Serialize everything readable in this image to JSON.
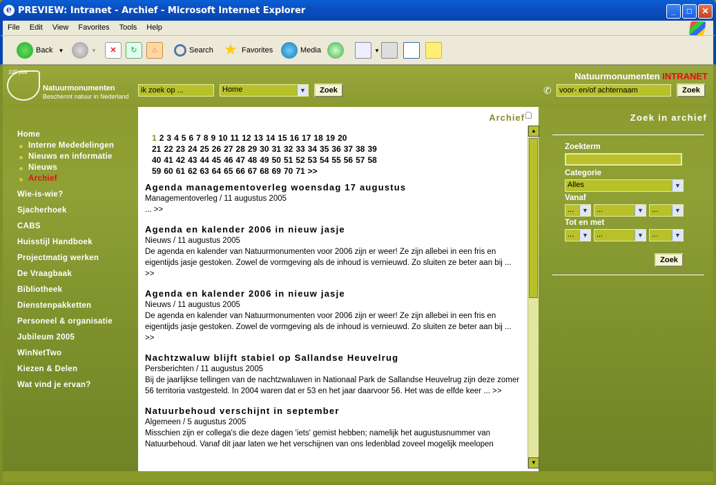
{
  "window": {
    "title": "PREVIEW: Intranet - Archief - Microsoft Internet Explorer",
    "min": "_",
    "max": "□",
    "close": "✕"
  },
  "menu": [
    "File",
    "Edit",
    "View",
    "Favorites",
    "Tools",
    "Help"
  ],
  "toolbar": {
    "back": "Back",
    "search": "Search",
    "favorites": "Favorites",
    "media": "Media"
  },
  "header": {
    "logo_year": "100 jaar",
    "logo_name": "Natuurmonumenten",
    "logo_tagline": "Beschermt natuur in Nederland",
    "search_placeholder": "ik zoek op ...",
    "scope_value": "Home",
    "search_button": "Zoek",
    "brand": "Natuurmonumenten",
    "brand_red": "INTRANET",
    "person_placeholder": "voor- en/of achternaam",
    "person_button": "Zoek"
  },
  "nav": {
    "home": "Home",
    "subs": [
      "Interne Mededelingen",
      "Nieuws en informatie",
      "Nieuws",
      "Archief"
    ],
    "items": [
      "Wie-is-wie?",
      "Sjacherhoek",
      "CABS",
      "Huisstijl Handboek",
      "Projectmatig werken",
      "De Vraagbaak",
      "Bibliotheek",
      "Dienstenpakketten",
      "Personeel & organisatie",
      "Jubileum 2005",
      "WinNetTwo",
      "Kiezen & Delen",
      "Wat vind je ervan?"
    ]
  },
  "content": {
    "title": "Archief",
    "pagination": [
      "1",
      "2",
      "3",
      "4",
      "5",
      "6",
      "7",
      "8",
      "9",
      "10",
      "11",
      "12",
      "13",
      "14",
      "15",
      "16",
      "17",
      "18",
      "19",
      "20",
      "21",
      "22",
      "23",
      "24",
      "25",
      "26",
      "27",
      "28",
      "29",
      "30",
      "31",
      "32",
      "33",
      "34",
      "35",
      "36",
      "37",
      "38",
      "39",
      "40",
      "41",
      "42",
      "43",
      "44",
      "45",
      "46",
      "47",
      "48",
      "49",
      "50",
      "51",
      "52",
      "53",
      "54",
      "55",
      "56",
      "57",
      "58",
      "59",
      "60",
      "61",
      "62",
      "63",
      "64",
      "65",
      "66",
      "67",
      "68",
      "69",
      "70",
      "71",
      ">>"
    ],
    "articles": [
      {
        "title": "Agenda managementoverleg woensdag 17 augustus",
        "meta": "Managementoverleg / 11 augustus 2005",
        "text": "... >>"
      },
      {
        "title": "Agenda en kalender 2006 in nieuw jasje",
        "meta": "Nieuws / 11 augustus 2005",
        "text": "De agenda en kalender van Natuurmonumenten voor 2006 zijn er weer! Ze zijn allebei in een fris en eigentijds jasje gestoken. Zowel de vormgeving als de inhoud is vernieuwd. Zo sluiten ze beter aan bij ... >>"
      },
      {
        "title": "Agenda en kalender 2006 in nieuw jasje",
        "meta": "Nieuws / 11 augustus 2005",
        "text": "De agenda en kalender van Natuurmonumenten voor 2006 zijn er weer! Ze zijn allebei in een fris en eigentijds jasje gestoken. Zowel de vormgeving als de inhoud is vernieuwd. Zo sluiten ze beter aan bij ... >>"
      },
      {
        "title": "Nachtzwaluw blijft stabiel op Sallandse Heuvelrug",
        "meta": "Persberichten / 11 augustus 2005",
        "text": "Bij de jaarlijkse tellingen van de nachtzwaluwen in Nationaal Park de Sallandse Heuvelrug zijn deze zomer 56 territoria vastgesteld. In 2004 waren dat er 53 en het jaar daarvoor 56. Het was de elfde keer ... >>"
      },
      {
        "title": "Natuurbehoud verschijnt in september",
        "meta": "Algemeen / 5 augustus 2005",
        "text": "Misschien zijn er collega's die deze dagen 'iets' gemist hebben; namelijk het augustusnummer van Natuurbehoud. Vanaf dit jaar laten we het verschijnen van ons ledenblad zoveel mogelijk meelopen"
      }
    ]
  },
  "archive_search": {
    "title": "Zoek in archief",
    "zoekterm_label": "Zoekterm",
    "categorie_label": "Categorie",
    "categorie_value": "Alles",
    "vanaf_label": "Vanaf",
    "totenmet_label": "Tot en met",
    "date_placeholder": "...",
    "button": "Zoek"
  }
}
